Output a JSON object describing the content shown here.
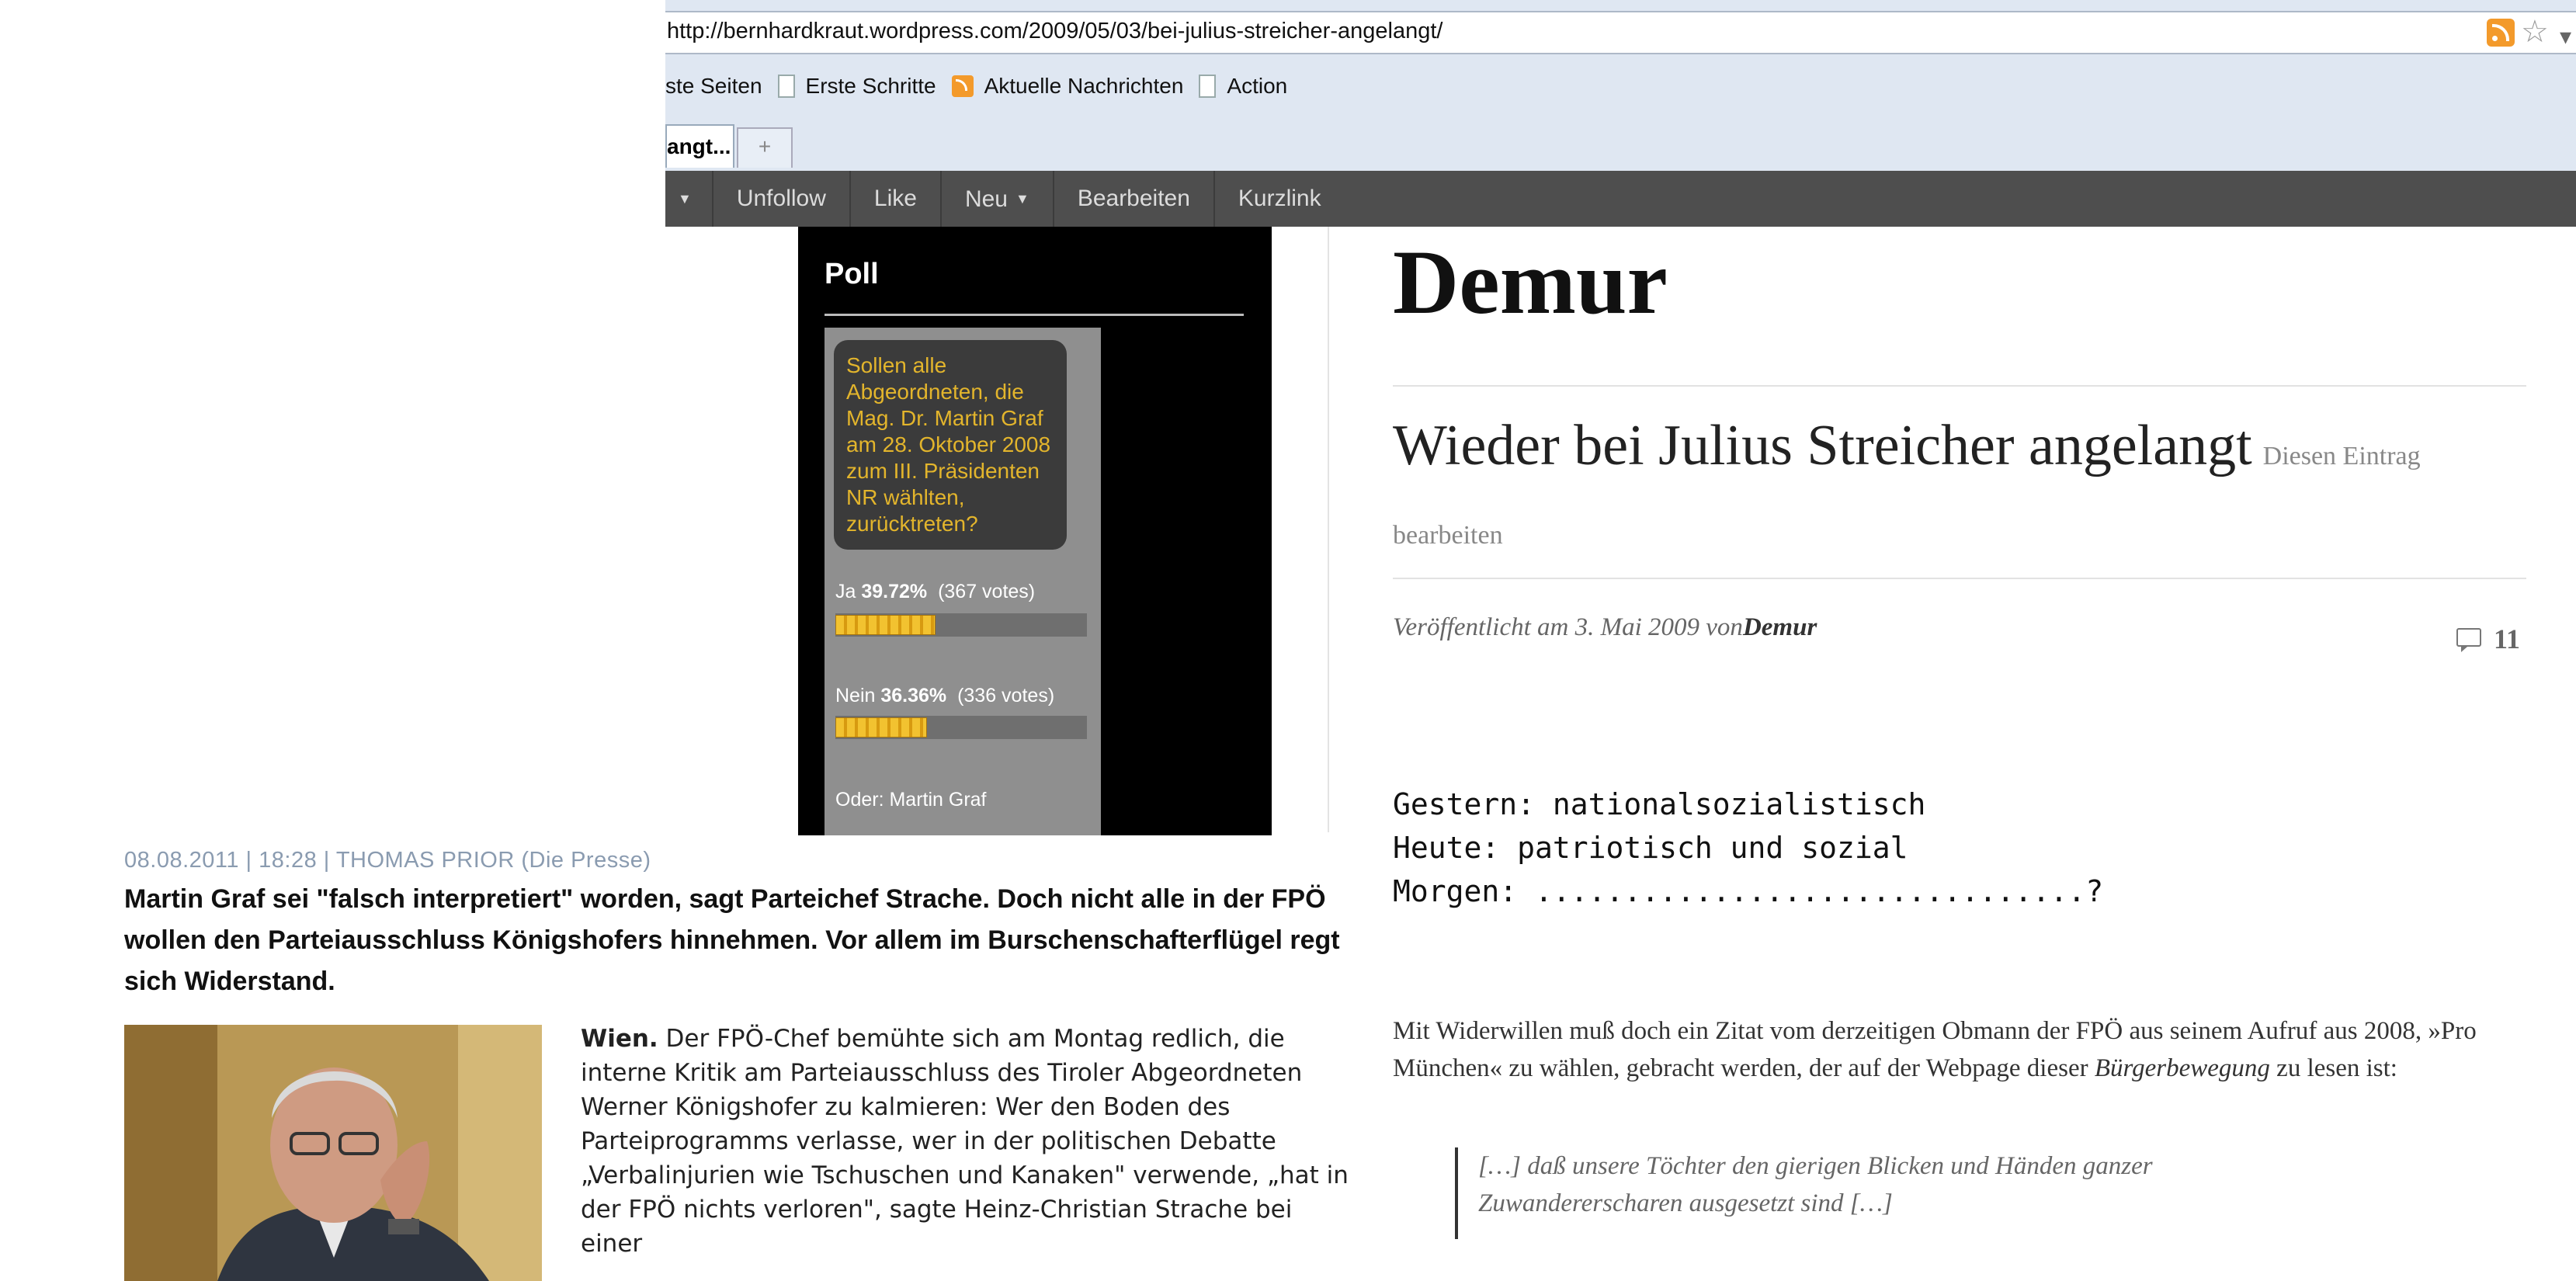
{
  "browser": {
    "url": "http://bernhardkraut.wordpress.com/2009/05/03/bei-julius-streicher-angelangt/",
    "bookmarks": [
      {
        "label": "ste Seiten",
        "icon": "none"
      },
      {
        "label": "Erste Schritte",
        "icon": "page-icon"
      },
      {
        "label": "Aktuelle Nachrichten",
        "icon": "feed-icon"
      },
      {
        "label": "Action",
        "icon": "page-icon"
      }
    ],
    "active_tab": "angt...",
    "new_tab": "+",
    "admin_bar": [
      "Unfollow",
      "Like",
      "Neu",
      "Bearbeiten",
      "Kurzlink"
    ]
  },
  "poll": {
    "title": "Poll",
    "question": "Sollen alle Abgeordneten, die Mag. Dr. Martin Graf am 28. Oktober 2008 zum III. Präsidenten NR wählten, zurücktreten?",
    "answers": [
      {
        "label": "Ja",
        "percent": "39.72%",
        "votes": "(367 votes)",
        "fraction": 0.3972
      },
      {
        "label": "Nein",
        "percent": "36.36%",
        "votes": "(336 votes)",
        "fraction": 0.3636
      },
      {
        "label": "Oder: Martin Graf"
      }
    ],
    "colors": {
      "question_text": "#e3b52c",
      "bar": "#f2c230"
    }
  },
  "blog": {
    "title": "Demur",
    "entry_title": "Wieder bei Julius Streicher angelangt",
    "edit_link": "Diesen Eintrag bearbeiten",
    "meta_prefix": "Veröffentlicht am 3. Mai 2009 von",
    "meta_author": "Demur",
    "comment_count": "11",
    "slogan": [
      "Gestern: nationalsozialistisch",
      "Heute: patriotisch und sozial",
      "Morgen: ...............................?"
    ],
    "para_part1": "Mit Widerwillen muß doch ein Zitat vom derzeitigen Obmann der FPÖ aus seinem Aufruf aus 2008, »Pro München« zu wählen, gebracht werden, der auf der Webpage dieser ",
    "para_em": "Bürgerbewegung",
    "para_part2": " zu lesen ist:",
    "quote": [
      "[…] daß unsere Töchter den gierigen Blicken und Händen ganzer",
      "Zuwandererscharen ausgesetzt sind […]"
    ]
  },
  "article": {
    "byline": "08.08.2011 | 18:28 |  THOMAS PRIOR (Die Presse)",
    "lead": "Martin Graf sei \"falsch interpretiert\" worden, sagt Parteichef Strache. Doch nicht alle in der FPÖ wollen den Parteiausschluss Königshofers hinnehmen. Vor allem im Burschenschafterflügel regt sich Widerstand.",
    "body_lead": "Wien.",
    "body": " Der FPÖ-Chef bemühte sich am Montag redlich, die interne Kritik am Parteiausschluss des Tiroler Abgeordneten Werner Königshofer zu kalmieren: Wer den Boden des Parteiprogramms verlasse, wer in der politischen Debatte „Verbalinjurien wie Tschuschen und Kanaken\" verwende, „hat in der FPÖ nichts verloren\", sagte Heinz-Christian Strache bei einer"
  }
}
